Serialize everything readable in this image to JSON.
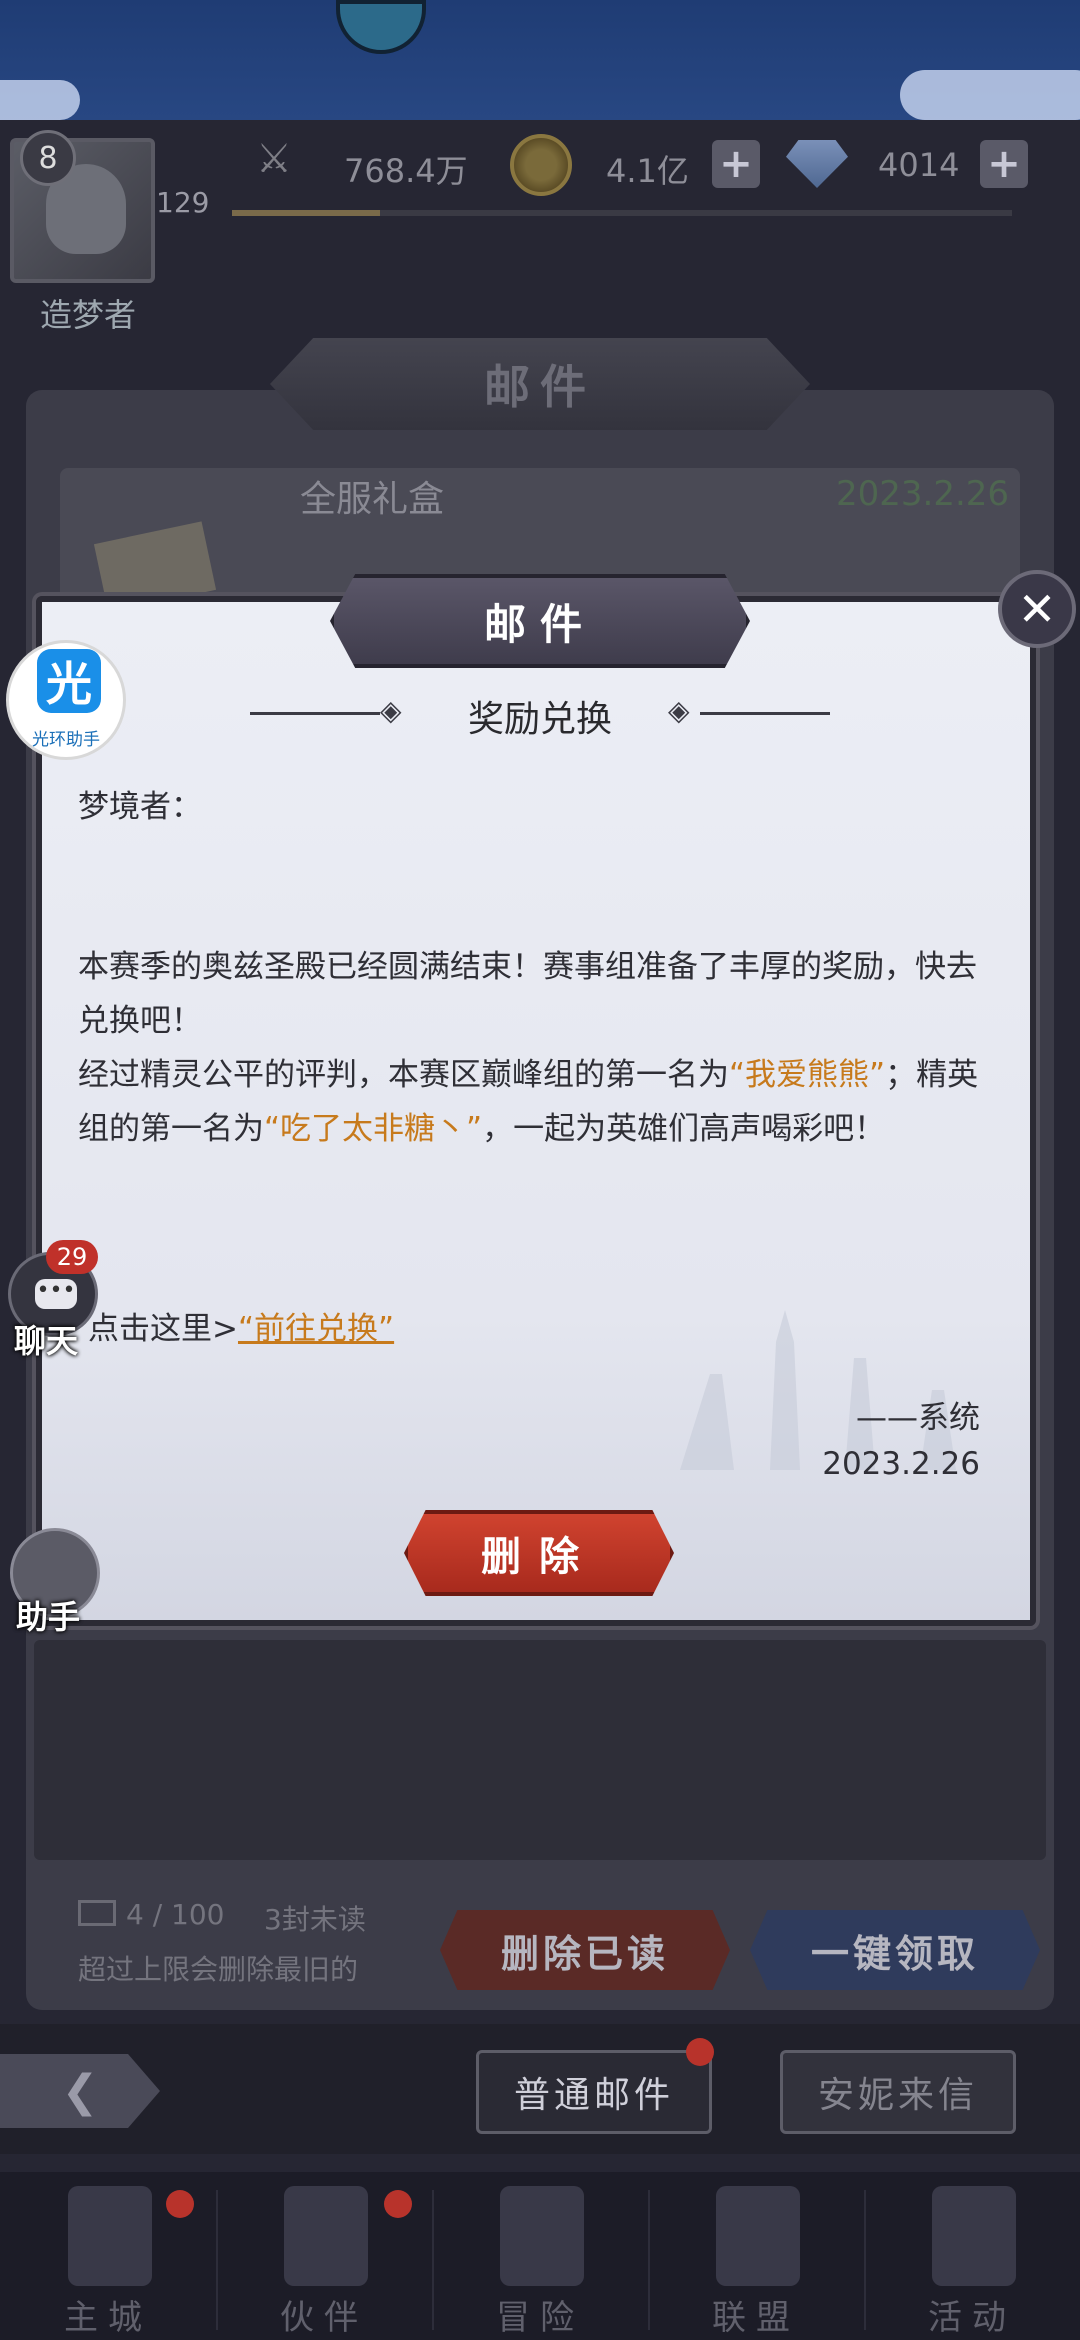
{
  "status_bar": {
    "player_level": "8",
    "player_level_num": "129",
    "player_title": "造梦者",
    "power": "768.4万",
    "gold": "4.1亿",
    "diamonds": "4014",
    "exp_progress": 0.19
  },
  "mail_window": {
    "title": "邮件",
    "list_item": {
      "name": "全服礼盒",
      "date": "2023.2.26"
    }
  },
  "modal": {
    "banner_title": "邮件",
    "subject": "奖励兑换",
    "greeting": "梦境者：",
    "paragraph1": "本赛季的奥兹圣殿已经圆满结束！赛事组准备了丰厚的奖励，快去兑换吧！",
    "p2_before": "经过精灵公平的评判，本赛区巅峰组的第一名为",
    "p2_name1": "“我爱熊熊”",
    "p2_mid": "；精英组的第一名为",
    "p2_name2": "“吃了太非糖丶”",
    "p2_after": "，一起为英雄们高声喝彩吧！",
    "click_prefix": "点击这里>",
    "click_link": "“前往兑换”",
    "sign": "——系统",
    "sign_date": "2023.2.26",
    "delete_button": "删除"
  },
  "floating": {
    "guanghuan_char": "光",
    "guanghuan_label": "光环助手",
    "chat_count": "29",
    "chat_label": "聊天",
    "helper_label": "助手"
  },
  "mail_footer": {
    "count": "4 / 100",
    "unread": "3封未读",
    "note": "超过上限会删除最旧的",
    "delete_read": "删除已读",
    "claim_all": "一键领取"
  },
  "tabs": {
    "normal_mail": "普通邮件",
    "annie_mail": "安妮来信"
  },
  "nav": [
    "主城",
    "伙伴",
    "冒险",
    "联盟",
    "活动"
  ],
  "colors": {
    "highlight": "#c77a1c",
    "delete_red": "#d0432f",
    "badge_red": "#c0312a"
  }
}
